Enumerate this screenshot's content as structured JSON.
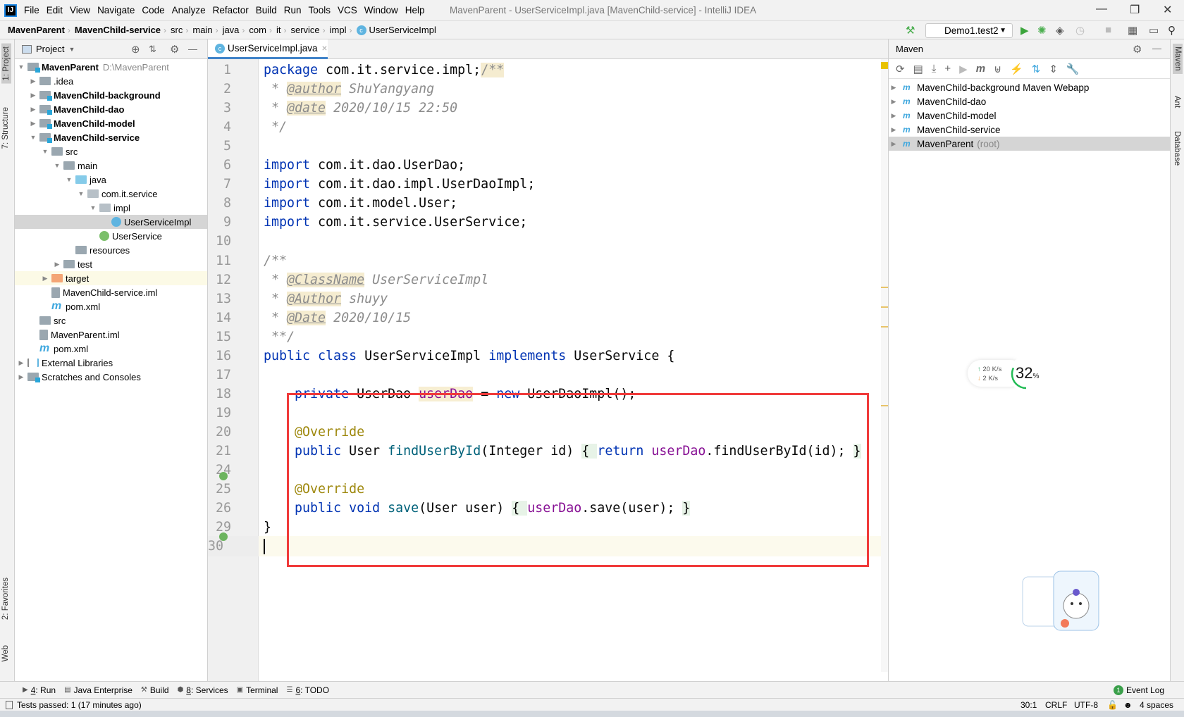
{
  "menu": {
    "items": [
      "File",
      "Edit",
      "View",
      "Navigate",
      "Code",
      "Analyze",
      "Refactor",
      "Build",
      "Run",
      "Tools",
      "VCS",
      "Window",
      "Help"
    ],
    "window_title": "MavenParent - UserServiceImpl.java [MavenChild-service] - IntelliJ IDEA"
  },
  "breadcrumb": [
    "MavenParent",
    "MavenChild-service",
    "src",
    "main",
    "java",
    "com",
    "it",
    "service",
    "impl",
    "UserServiceImpl"
  ],
  "toolbar": {
    "run_config": "Demo1.test2"
  },
  "left_stripe": {
    "project": "1: Project",
    "structure": "7: Structure",
    "favorites": "2: Favorites",
    "web": "Web"
  },
  "project": {
    "title": "Project",
    "tree": [
      {
        "label": "MavenParent",
        "extra": "D:\\MavenParent",
        "depth": 0,
        "arrow": "down",
        "icon": "module-folder",
        "bold": true
      },
      {
        "label": ".idea",
        "depth": 1,
        "arrow": "right",
        "icon": "folder"
      },
      {
        "label": "MavenChild-background",
        "depth": 1,
        "arrow": "right",
        "icon": "module-folder",
        "bold": true
      },
      {
        "label": "MavenChild-dao",
        "depth": 1,
        "arrow": "right",
        "icon": "module-folder",
        "bold": true
      },
      {
        "label": "MavenChild-model",
        "depth": 1,
        "arrow": "right",
        "icon": "module-folder",
        "bold": true
      },
      {
        "label": "MavenChild-service",
        "depth": 1,
        "arrow": "down",
        "icon": "module-folder",
        "bold": true
      },
      {
        "label": "src",
        "depth": 2,
        "arrow": "down",
        "icon": "folder"
      },
      {
        "label": "main",
        "depth": 3,
        "arrow": "down",
        "icon": "folder"
      },
      {
        "label": "java",
        "depth": 4,
        "arrow": "down",
        "icon": "source-folder"
      },
      {
        "label": "com.it.service",
        "depth": 5,
        "arrow": "down",
        "icon": "package"
      },
      {
        "label": "impl",
        "depth": 6,
        "arrow": "down",
        "icon": "package"
      },
      {
        "label": "UserServiceImpl",
        "depth": 7,
        "arrow": "",
        "icon": "class",
        "selected": true
      },
      {
        "label": "UserService",
        "depth": 6,
        "arrow": "",
        "icon": "interface"
      },
      {
        "label": "resources",
        "depth": 4,
        "arrow": "",
        "icon": "folder"
      },
      {
        "label": "test",
        "depth": 3,
        "arrow": "right",
        "icon": "folder"
      },
      {
        "label": "target",
        "depth": 2,
        "arrow": "right",
        "icon": "excluded-folder",
        "highlight": true
      },
      {
        "label": "MavenChild-service.iml",
        "depth": 2,
        "arrow": "",
        "icon": "file"
      },
      {
        "label": "pom.xml",
        "depth": 2,
        "arrow": "",
        "icon": "maven"
      },
      {
        "label": "src",
        "depth": 1,
        "arrow": "",
        "icon": "folder"
      },
      {
        "label": "MavenParent.iml",
        "depth": 1,
        "arrow": "",
        "icon": "file"
      },
      {
        "label": "pom.xml",
        "depth": 1,
        "arrow": "",
        "icon": "maven"
      },
      {
        "label": "External Libraries",
        "depth": 0,
        "arrow": "right",
        "icon": "library"
      },
      {
        "label": "Scratches and Consoles",
        "depth": 0,
        "arrow": "right",
        "icon": "scratches"
      }
    ]
  },
  "editor": {
    "tab": "UserServiceImpl.java",
    "lines": [
      {
        "n": "1",
        "t": [
          [
            "kw",
            "package"
          ],
          [
            "pl",
            " com.it.service.impl;"
          ],
          [
            "cmhl",
            "/**"
          ]
        ]
      },
      {
        "n": "2",
        "t": [
          [
            "cm",
            " * "
          ],
          [
            "tag",
            "@author"
          ],
          [
            "cm",
            " ShuYangyang"
          ]
        ]
      },
      {
        "n": "3",
        "t": [
          [
            "cm",
            " * "
          ],
          [
            "tag",
            "@date"
          ],
          [
            "cm",
            " 2020/10/15 22:50"
          ]
        ]
      },
      {
        "n": "4",
        "t": [
          [
            "cm",
            " */"
          ]
        ]
      },
      {
        "n": "5",
        "t": []
      },
      {
        "n": "6",
        "t": [
          [
            "kw",
            "import"
          ],
          [
            "pl",
            " com.it.dao.UserDao;"
          ]
        ]
      },
      {
        "n": "7",
        "t": [
          [
            "kw",
            "import"
          ],
          [
            "pl",
            " com.it.dao.impl.UserDaoImpl;"
          ]
        ]
      },
      {
        "n": "8",
        "t": [
          [
            "kw",
            "import"
          ],
          [
            "pl",
            " com.it.model.User;"
          ]
        ]
      },
      {
        "n": "9",
        "t": [
          [
            "kw",
            "import"
          ],
          [
            "pl",
            " com.it.service.UserService;"
          ]
        ]
      },
      {
        "n": "10",
        "t": []
      },
      {
        "n": "11",
        "t": [
          [
            "cm",
            "/**"
          ]
        ]
      },
      {
        "n": "12",
        "t": [
          [
            "cm",
            " * "
          ],
          [
            "tag",
            "@ClassName"
          ],
          [
            "cm",
            " UserServiceImpl"
          ]
        ]
      },
      {
        "n": "13",
        "t": [
          [
            "cm",
            " * "
          ],
          [
            "tag",
            "@Author"
          ],
          [
            "cm",
            " shuyy"
          ]
        ]
      },
      {
        "n": "14",
        "t": [
          [
            "cm",
            " * "
          ],
          [
            "tag",
            "@Date"
          ],
          [
            "cm",
            " 2020/10/15"
          ]
        ]
      },
      {
        "n": "15",
        "t": [
          [
            "cm",
            " **/"
          ]
        ]
      },
      {
        "n": "16",
        "t": [
          [
            "kw",
            "public class"
          ],
          [
            "pl",
            " UserServiceImpl "
          ],
          [
            "kw",
            "implements"
          ],
          [
            "pl",
            " UserService {"
          ]
        ]
      },
      {
        "n": "17",
        "t": []
      },
      {
        "n": "18",
        "t": [
          [
            "pl",
            "    "
          ],
          [
            "kw",
            "private"
          ],
          [
            "pl",
            " UserDao "
          ],
          [
            "fldhl",
            "userDao"
          ],
          [
            "pl",
            " = "
          ],
          [
            "kw",
            "new"
          ],
          [
            "pl",
            " UserDaoImpl();"
          ]
        ]
      },
      {
        "n": "19",
        "t": []
      },
      {
        "n": "20",
        "t": [
          [
            "pl",
            "    "
          ],
          [
            "ann",
            "@Override"
          ]
        ]
      },
      {
        "n": "21",
        "t": [
          [
            "pl",
            "    "
          ],
          [
            "kw",
            "public"
          ],
          [
            "pl",
            " User "
          ],
          [
            "fn",
            "findUserById"
          ],
          [
            "pl",
            "(Integer id) "
          ],
          [
            "fold",
            "{ "
          ],
          [
            "kw",
            "return "
          ],
          [
            "fld",
            "userDao"
          ],
          [
            "pl",
            ".findUserById(id); "
          ],
          [
            "fold",
            "}"
          ]
        ]
      },
      {
        "n": "24",
        "t": []
      },
      {
        "n": "25",
        "t": [
          [
            "pl",
            "    "
          ],
          [
            "ann",
            "@Override"
          ]
        ]
      },
      {
        "n": "26",
        "t": [
          [
            "pl",
            "    "
          ],
          [
            "kw",
            "public void "
          ],
          [
            "fn",
            "save"
          ],
          [
            "pl",
            "(User user) "
          ],
          [
            "fold",
            "{ "
          ],
          [
            "fld",
            "userDao"
          ],
          [
            "pl",
            ".save(user); "
          ],
          [
            "fold",
            "}"
          ]
        ]
      },
      {
        "n": "29",
        "t": [
          [
            "pl",
            "}"
          ]
        ]
      },
      {
        "n": "30",
        "t": [],
        "current": true
      }
    ]
  },
  "maven": {
    "title": "Maven",
    "projects": [
      {
        "label": "MavenChild-background Maven Webapp"
      },
      {
        "label": "MavenChild-dao"
      },
      {
        "label": "MavenChild-model"
      },
      {
        "label": "MavenChild-service"
      },
      {
        "label": "MavenParent",
        "extra": "(root)",
        "selected": true
      }
    ]
  },
  "right_stripe": {
    "maven": "Maven",
    "ant": "Ant",
    "database": "Database"
  },
  "net_widget": {
    "up": "20  K/s",
    "down": "2   K/s",
    "percent": "32",
    "percent_sign": "%",
    "percent_value": 32
  },
  "bottom_tools": [
    {
      "key": "4",
      "label": ": Run"
    },
    {
      "key": "",
      "label": "Java Enterprise"
    },
    {
      "key": "",
      "label": "Build"
    },
    {
      "key": "8",
      "label": ": Services"
    },
    {
      "key": "",
      "label": "Terminal"
    },
    {
      "key": "6",
      "label": ": TODO"
    }
  ],
  "event_log": {
    "count": "1",
    "label": "Event Log"
  },
  "status": {
    "message": "Tests passed: 1 (17 minutes ago)",
    "position": "30:1",
    "line_sep": "CRLF",
    "encoding": "UTF-8",
    "indent": "4 spaces"
  },
  "colors": {
    "keyword": "#0033b3",
    "annotation": "#9e880d",
    "field": "#871094",
    "method": "#00627a",
    "comment": "#8c8c8c",
    "highlight_box": "#f03a3a",
    "accent": "#4083c9"
  }
}
